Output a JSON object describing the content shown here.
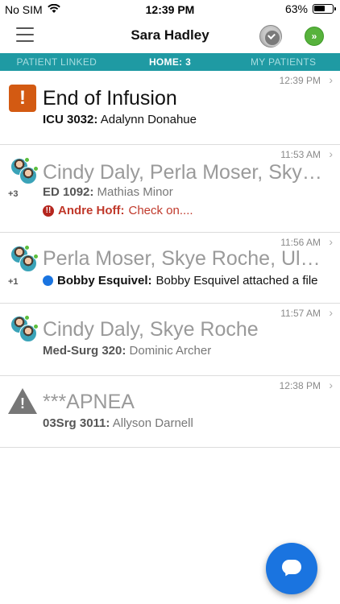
{
  "status_bar": {
    "carrier": "No SIM",
    "time": "12:39 PM",
    "battery": "63%",
    "battery_level": 0.63
  },
  "nav": {
    "title": "Sara Hadley"
  },
  "tabs": [
    {
      "label": "PATIENT LINKED",
      "active": false
    },
    {
      "label": "HOME: 3",
      "active": true
    },
    {
      "label": "MY PATIENTS",
      "active": false
    }
  ],
  "rows": [
    {
      "timestamp": "12:39 PM",
      "title": "End of Infusion",
      "sub_bold": "ICU 3032:",
      "sub_text": "Adalynn Donahue"
    },
    {
      "timestamp": "11:53 AM",
      "title": "Cindy Daly, Perla Moser, Skye Roche",
      "avatar_count": "+3",
      "sub_bold": "ED 1092:",
      "sub_text": "Mathias Minor",
      "alert_name": "Andre Hoff:",
      "alert_text": "Check on...."
    },
    {
      "timestamp": "11:56 AM",
      "title": "Perla Moser, Skye Roche, Ulises",
      "avatar_count": "+1",
      "msg_name": "Bobby Esquivel:",
      "msg_text": "Bobby Esquivel attached a file"
    },
    {
      "timestamp": "11:57 AM",
      "title": "Cindy Daly, Skye Roche",
      "sub_bold": "Med-Surg 320:",
      "sub_text": "Dominic Archer"
    },
    {
      "timestamp": "12:38 PM",
      "title": "***APNEA",
      "sub_bold": "03Srg 3011:",
      "sub_text": "Allyson Darnell"
    }
  ]
}
